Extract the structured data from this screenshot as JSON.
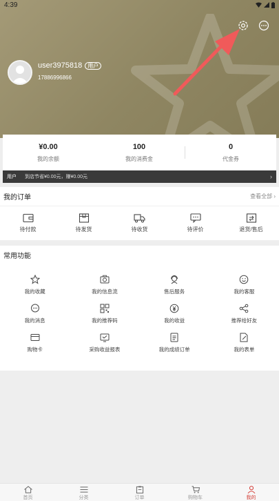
{
  "status_bar": {
    "time": "4:39"
  },
  "user": {
    "name": "user3975818",
    "tag": "用户",
    "phone": "17886996866"
  },
  "stats": [
    {
      "value": "¥0.00",
      "label": "我的余额"
    },
    {
      "value": "100",
      "label": "我的消费金"
    },
    {
      "value": "0",
      "label": "代金券"
    }
  ],
  "promo": {
    "pill": "用户",
    "text": "到店节省¥0.00元，赚¥0.00元"
  },
  "orders": {
    "title": "我的订单",
    "more": "查看全部",
    "items": [
      {
        "label": "待付款",
        "icon": "wallet-icon"
      },
      {
        "label": "待发货",
        "icon": "box-icon"
      },
      {
        "label": "待收货",
        "icon": "truck-icon"
      },
      {
        "label": "待评价",
        "icon": "comment-icon"
      },
      {
        "label": "退货/售后",
        "icon": "return-icon"
      }
    ]
  },
  "functions": {
    "title": "常用功能",
    "items": [
      {
        "label": "我的收藏",
        "icon": "star-icon"
      },
      {
        "label": "我的信息流",
        "icon": "camera-icon"
      },
      {
        "label": "售后服务",
        "icon": "service-icon"
      },
      {
        "label": "我的客服",
        "icon": "smile-icon"
      },
      {
        "label": "我的消息",
        "icon": "message-icon"
      },
      {
        "label": "我的推荐码",
        "icon": "qrcode-icon"
      },
      {
        "label": "我的收益",
        "icon": "yen-icon"
      },
      {
        "label": "推荐给好友",
        "icon": "share-icon"
      },
      {
        "label": "购物卡",
        "icon": "card-icon"
      },
      {
        "label": "采购收益报表",
        "icon": "report-icon"
      },
      {
        "label": "我的成绩订单",
        "icon": "doc-icon"
      },
      {
        "label": "我的表单",
        "icon": "form-icon"
      }
    ]
  },
  "nav": [
    {
      "label": "首页",
      "icon": "home-icon"
    },
    {
      "label": "分类",
      "icon": "list-icon"
    },
    {
      "label": "订单",
      "icon": "clipboard-icon"
    },
    {
      "label": "购物车",
      "icon": "cart-icon"
    },
    {
      "label": "我的",
      "icon": "user-icon"
    }
  ],
  "colors": {
    "header": "#978e69",
    "accent": "#d4403a",
    "arrow": "#f05a5a"
  }
}
